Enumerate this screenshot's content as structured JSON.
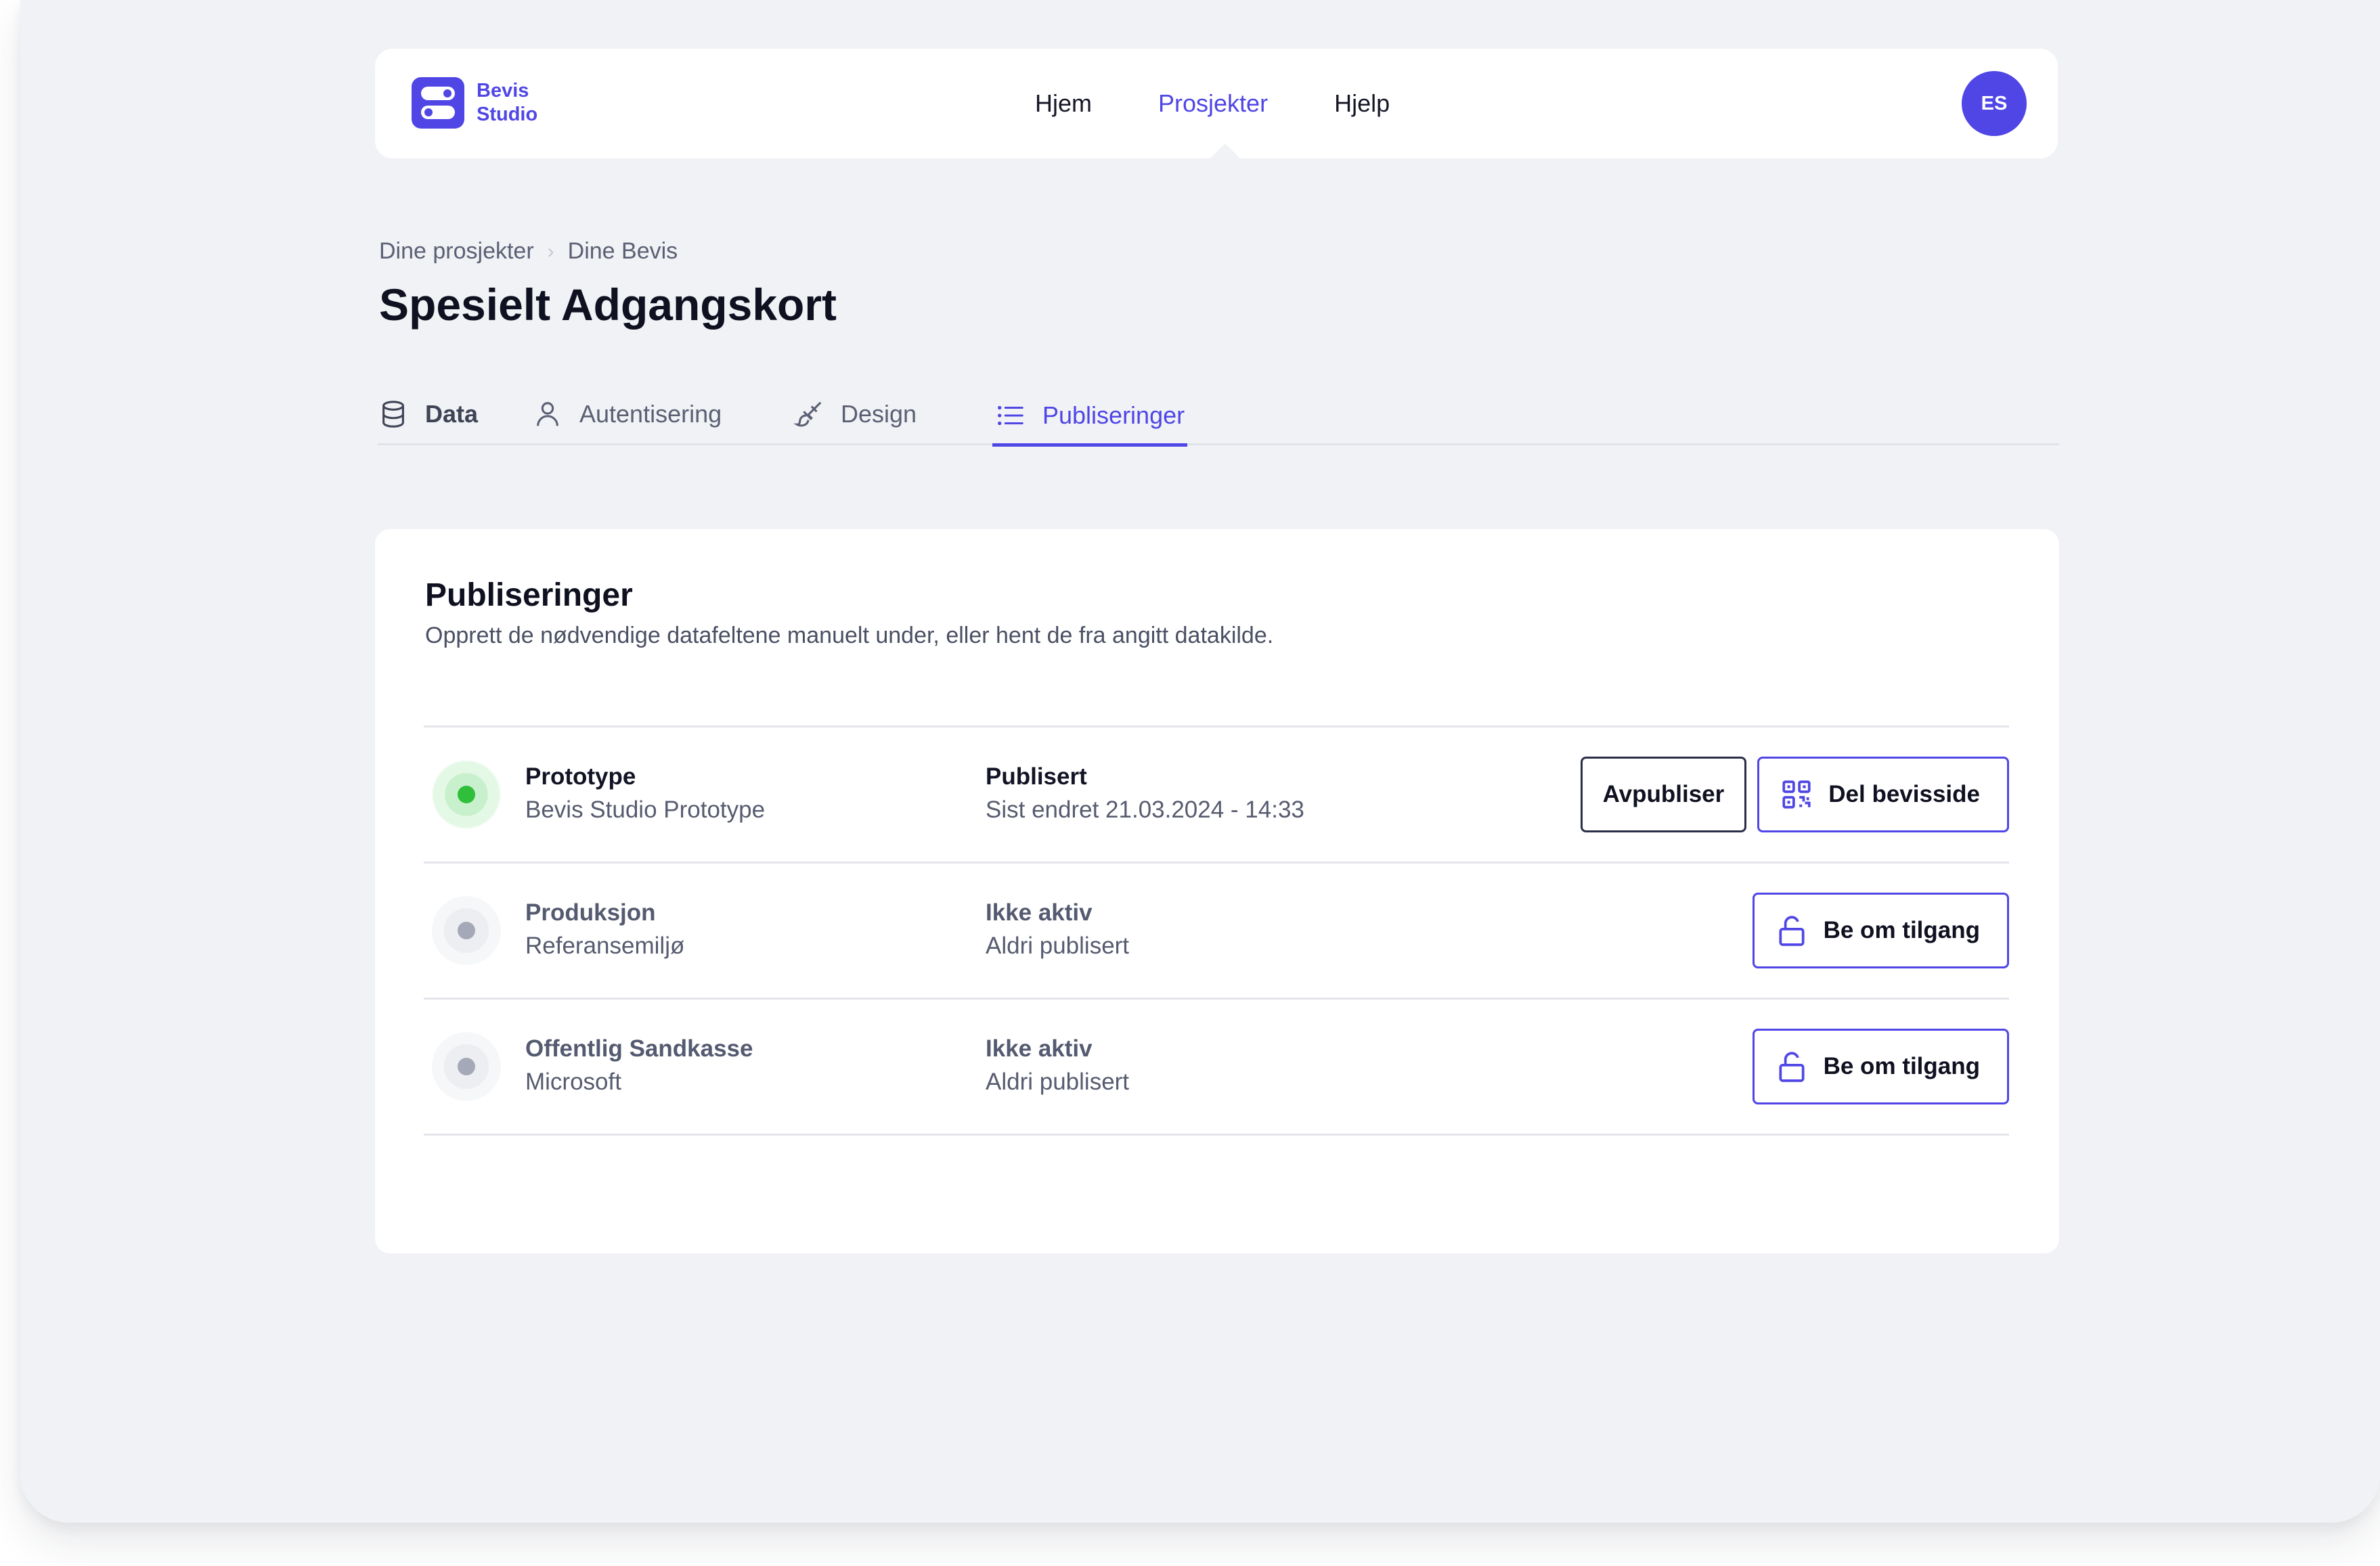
{
  "app": {
    "logo_line1": "Bevis",
    "logo_line2": "Studio",
    "brand_color": "#4f46e5"
  },
  "nav": {
    "items": [
      {
        "label": "Hjem",
        "active": false
      },
      {
        "label": "Prosjekter",
        "active": true
      },
      {
        "label": "Hjelp",
        "active": false
      }
    ],
    "avatar_initials": "ES"
  },
  "breadcrumb": [
    "Dine prosjekter",
    "Dine Bevis"
  ],
  "page_title": "Spesielt Adgangskort",
  "tabs": [
    {
      "label": "Data",
      "icon": "database-icon",
      "active": false
    },
    {
      "label": "Autentisering",
      "icon": "user-icon",
      "active": false
    },
    {
      "label": "Design",
      "icon": "paintbrush-icon",
      "active": false
    },
    {
      "label": "Publiseringer",
      "icon": "list-icon",
      "active": true
    }
  ],
  "card": {
    "title": "Publiseringer",
    "subtitle": "Opprett de nødvendige datafeltene manuelt under, eller hent de fra angitt datakilde."
  },
  "environments": [
    {
      "name": "Prototype",
      "description": "Bevis Studio Prototype",
      "status": "Publisert",
      "status_detail": "Sist endret 21.03.2024 - 14:33",
      "active": true,
      "actions": [
        "Avpubliser",
        "Del bevisside"
      ]
    },
    {
      "name": "Produksjon",
      "description": "Referansemiljø",
      "status": "Ikke aktiv",
      "status_detail": "Aldri publisert",
      "active": false,
      "actions": [
        "Be om tilgang"
      ]
    },
    {
      "name": "Offentlig Sandkasse",
      "description": "Microsoft",
      "status": "Ikke aktiv",
      "status_detail": "Aldri publisert",
      "active": false,
      "actions": [
        "Be om tilgang"
      ]
    }
  ]
}
